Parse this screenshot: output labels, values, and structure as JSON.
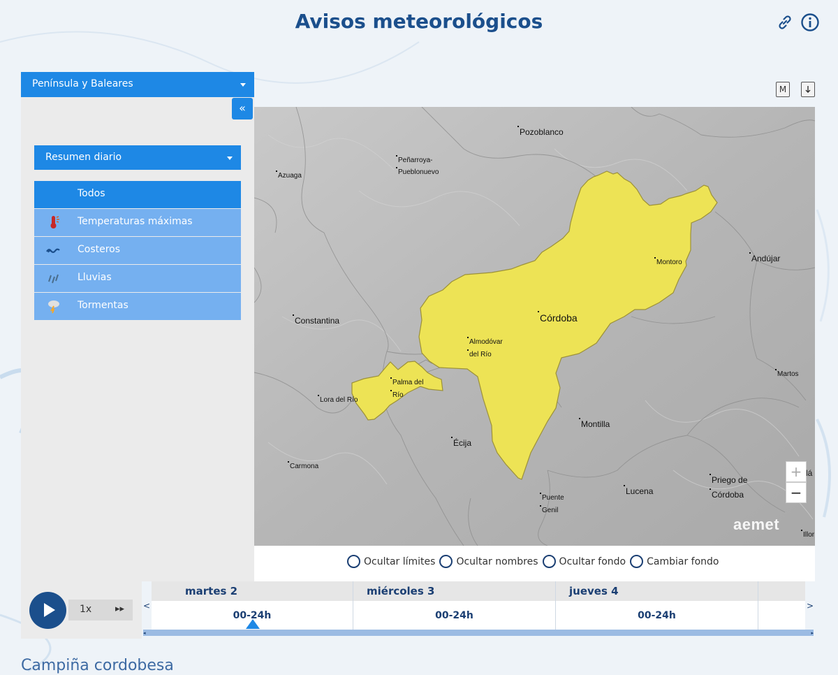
{
  "header": {
    "title": "Avisos meteorológicos",
    "link_icon": "link-icon",
    "info_icon": "info-icon"
  },
  "sidebar": {
    "region_select": "Península y Baleares",
    "collapse_label": "«",
    "summary_select": "Resumen diario",
    "types": [
      {
        "label": "Todos",
        "icon": "",
        "active": true
      },
      {
        "label": "Temperaturas máximas",
        "icon": "thermometer-icon",
        "active": false
      },
      {
        "label": "Costeros",
        "icon": "waves-icon",
        "active": false
      },
      {
        "label": "Lluvias",
        "icon": "rain-icon",
        "active": false
      },
      {
        "label": "Tormentas",
        "icon": "storm-icon",
        "active": false
      }
    ]
  },
  "map_tools": {
    "m_label": "M",
    "download_icon": "download-icon"
  },
  "map": {
    "places": {
      "pozoblanco": "Pozoblanco",
      "penarroya": "Peñarroya-",
      "penarroya2": "Pueblonuevo",
      "azuaga": "Azuaga",
      "andujar": "Andújar",
      "montoro": "Montoro",
      "cordoba": "Córdoba",
      "constantina": "Constantina",
      "almodovar": "Almodóvar",
      "almodovar2": "del Río",
      "martos": "Martos",
      "palma": "Palma del",
      "palma2": "Río",
      "lora": "Lora del Río",
      "montilla": "Montilla",
      "ecija": "Écija",
      "carmona": "Carmona",
      "priego": "Priego de",
      "priego2": "Córdoba",
      "lucena": "Lucena",
      "puente": "Puente",
      "puente2": "Genil",
      "ilo": "Illor",
      "la": "lá"
    },
    "zoom_in": "+",
    "zoom_out": "−",
    "watermark": "aemet",
    "warning_color": "#ede355"
  },
  "options": {
    "hide_limits": "Ocultar límites",
    "hide_names": "Ocultar nombres",
    "hide_background": "Ocultar fondo",
    "change_background": "Cambiar fondo"
  },
  "timeline": {
    "speed": "1x",
    "fast_forward": "▸▸",
    "prev": "<",
    "next": ">",
    "days": [
      {
        "name": "martes 2",
        "period": "00-24h"
      },
      {
        "name": "miércoles 3",
        "period": "00-24h"
      },
      {
        "name": "jueves 4",
        "period": "00-24h"
      },
      {
        "name": "",
        "period": ""
      }
    ]
  },
  "zone": {
    "title": "Campiña cordobesa"
  }
}
